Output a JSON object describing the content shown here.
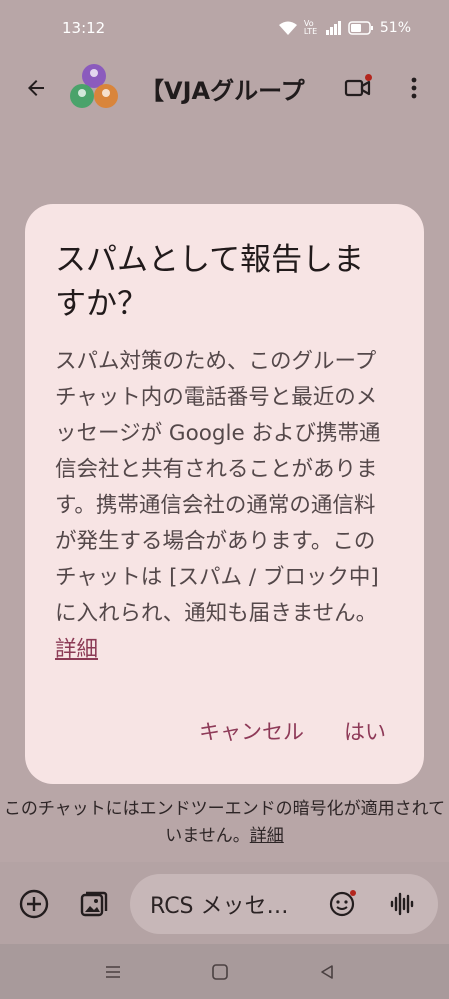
{
  "status_bar": {
    "time": "13:12",
    "network": "Vo LTE",
    "battery": "51%",
    "icons": [
      "wifi-icon",
      "signal-icon",
      "battery-icon"
    ]
  },
  "app_bar": {
    "back_icon": "arrow-left-icon",
    "title": "【VJAグループ",
    "video_icon": "video-call-icon",
    "more_icon": "more-vert-icon"
  },
  "dialog": {
    "title": "スパムとして報告しますか？",
    "body": "スパム対策のため、このグループ チャット内の電話番号と最近のメッセージが Google および携帯通信会社と共有されることがあります。携帯通信会社の通常の通信料が発生する場合があります。このチャットは [スパム / ブロック中] に入れられ、通知も届きません。",
    "details_link": "詳細",
    "cancel_label": "キャンセル",
    "confirm_label": "はい"
  },
  "e2e_notice": {
    "text": "このチャットにはエンドツーエンドの暗号化が適用されていません。",
    "details_link": "詳細"
  },
  "compose": {
    "placeholder": "RCS メッセージ",
    "add_icon": "add-circle-icon",
    "gallery_icon": "gallery-icon",
    "emoji_icon": "emoji-icon",
    "voice_icon": "voice-waveform-icon"
  },
  "nav_bar": {
    "icons": [
      "menu-icon",
      "home-icon",
      "back-icon"
    ]
  },
  "colors": {
    "accent": "#8e3a58",
    "dialog_bg": "#f7e4e4",
    "scrim_bg": "#b8a6a7"
  }
}
